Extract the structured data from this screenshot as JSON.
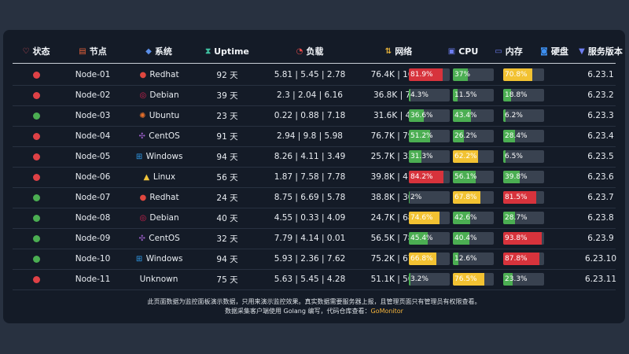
{
  "colors": {
    "online": "#4bae52",
    "offline": "#df4146",
    "bar_green": "#4bae52",
    "bar_yellow": "#f2c232",
    "bar_red": "#d7333c",
    "bar_track": "#394250",
    "link": "#f4b33b"
  },
  "headers": [
    {
      "key": "status",
      "label": "状态",
      "icon": "heart-pulse-icon",
      "glyph": "♡",
      "color": "#e35560"
    },
    {
      "key": "node",
      "label": "节点",
      "icon": "server-icon",
      "glyph": "▤",
      "color": "#e8623a"
    },
    {
      "key": "os",
      "label": "系统",
      "icon": "layers-icon",
      "glyph": "◆",
      "color": "#5b8fe8"
    },
    {
      "key": "uptime",
      "label": "Uptime",
      "icon": "hourglass-icon",
      "glyph": "⧗",
      "color": "#3fc0a0"
    },
    {
      "key": "load",
      "label": "负载",
      "icon": "gauge-icon",
      "glyph": "◔",
      "color": "#e24a4a"
    },
    {
      "key": "network",
      "label": "网络",
      "icon": "updown-arrows-icon",
      "glyph": "⇅",
      "color": "#e6b23a"
    },
    {
      "key": "cpu",
      "label": "CPU",
      "icon": "cpu-icon",
      "glyph": "▣",
      "color": "#6d7df0"
    },
    {
      "key": "memory",
      "label": "内存",
      "icon": "memory-icon",
      "glyph": "▭",
      "color": "#6d7df0"
    },
    {
      "key": "disk",
      "label": "硬盘",
      "icon": "disk-icon",
      "glyph": "◙",
      "color": "#3d8ff0"
    },
    {
      "key": "version",
      "label": "服务版本",
      "icon": "version-icon",
      "glyph": "▼",
      "color": "#6d7df0"
    }
  ],
  "rows": [
    {
      "status": "offline",
      "node": "Node-01",
      "os": "Redhat",
      "os_icon": "redhat-icon",
      "os_glyph": "●",
      "os_color": "#e0473f",
      "uptime": "92 天",
      "load": "5.81 | 5.45 | 2.78",
      "network": "76.4K | 16.8K",
      "cpu": 81.9,
      "cpu_label": "81.9%",
      "memory": 37,
      "memory_label": "37%",
      "disk": 70.8,
      "disk_label": "70.8%",
      "version": "6.23.1"
    },
    {
      "status": "offline",
      "node": "Node-02",
      "os": "Debian",
      "os_icon": "debian-icon",
      "os_glyph": "◎",
      "os_color": "#d7214f",
      "uptime": "39 天",
      "load": "2.3 | 2.04 | 6.16",
      "network": "36.8K | 7.5K",
      "cpu": 4.3,
      "cpu_label": "4.3%",
      "memory": 11.5,
      "memory_label": "11.5%",
      "disk": 18.8,
      "disk_label": "18.8%",
      "version": "6.23.2"
    },
    {
      "status": "online",
      "node": "Node-03",
      "os": "Ubuntu",
      "os_icon": "ubuntu-icon",
      "os_glyph": "✺",
      "os_color": "#e8702a",
      "uptime": "23 天",
      "load": "0.22 | 0.88 | 7.18",
      "network": "31.6K | 4.8K",
      "cpu": 36.6,
      "cpu_label": "36.6%",
      "memory": 43.4,
      "memory_label": "43.4%",
      "disk": 6.2,
      "disk_label": "6.2%",
      "version": "6.23.3"
    },
    {
      "status": "offline",
      "node": "Node-04",
      "os": "CentOS",
      "os_icon": "centos-icon",
      "os_glyph": "✣",
      "os_color": "#9c5ec9",
      "uptime": "91 天",
      "load": "2.94 | 9.8 | 5.98",
      "network": "76.7K | 79.5K",
      "cpu": 51.2,
      "cpu_label": "51.2%",
      "memory": 26.2,
      "memory_label": "26.2%",
      "disk": 28.4,
      "disk_label": "28.4%",
      "version": "6.23.4"
    },
    {
      "status": "offline",
      "node": "Node-05",
      "os": "Windows",
      "os_icon": "windows-icon",
      "os_glyph": "⊞",
      "os_color": "#2f9ae8",
      "uptime": "94 天",
      "load": "8.26 | 4.11 | 3.49",
      "network": "25.7K | 33.8K",
      "cpu": 31.3,
      "cpu_label": "31.3%",
      "memory": 62.2,
      "memory_label": "62.2%",
      "disk": 6.5,
      "disk_label": "6.5%",
      "version": "6.23.5"
    },
    {
      "status": "offline",
      "node": "Node-06",
      "os": "Linux",
      "os_icon": "linux-icon",
      "os_glyph": "▲",
      "os_color": "#f0c43a",
      "uptime": "56 天",
      "load": "1.87 | 7.58 | 7.78",
      "network": "39.8K | 41.3K",
      "cpu": 84.2,
      "cpu_label": "84.2%",
      "memory": 56.1,
      "memory_label": "56.1%",
      "disk": 39.8,
      "disk_label": "39.8%",
      "version": "6.23.6"
    },
    {
      "status": "online",
      "node": "Node-07",
      "os": "Redhat",
      "os_icon": "redhat-icon",
      "os_glyph": "●",
      "os_color": "#e0473f",
      "uptime": "24 天",
      "load": "8.75 | 6.69 | 5.78",
      "network": "38.8K | 30.7K",
      "cpu": 2,
      "cpu_label": "2%",
      "memory": 67.8,
      "memory_label": "67.8%",
      "disk": 81.5,
      "disk_label": "81.5%",
      "version": "6.23.7"
    },
    {
      "status": "online",
      "node": "Node-08",
      "os": "Debian",
      "os_icon": "debian-icon",
      "os_glyph": "◎",
      "os_color": "#d7214f",
      "uptime": "40 天",
      "load": "4.55 | 0.33 | 4.09",
      "network": "24.7K | 68.1K",
      "cpu": 74.6,
      "cpu_label": "74.6%",
      "memory": 42.6,
      "memory_label": "42.6%",
      "disk": 28.7,
      "disk_label": "28.7%",
      "version": "6.23.8"
    },
    {
      "status": "online",
      "node": "Node-09",
      "os": "CentOS",
      "os_icon": "centos-icon",
      "os_glyph": "✣",
      "os_color": "#9c5ec9",
      "uptime": "32 天",
      "load": "7.79 | 4.14 | 0.01",
      "network": "56.5K | 78.1K",
      "cpu": 45.4,
      "cpu_label": "45.4%",
      "memory": 40.4,
      "memory_label": "40.4%",
      "disk": 93.8,
      "disk_label": "93.8%",
      "version": "6.23.9"
    },
    {
      "status": "online",
      "node": "Node-10",
      "os": "Windows",
      "os_icon": "windows-icon",
      "os_glyph": "⊞",
      "os_color": "#2f9ae8",
      "uptime": "94 天",
      "load": "5.93 | 2.36 | 7.62",
      "network": "75.2K | 67.4K",
      "cpu": 66.8,
      "cpu_label": "66.8%",
      "memory": 12.6,
      "memory_label": "12.6%",
      "disk": 87.8,
      "disk_label": "87.8%",
      "version": "6.23.10"
    },
    {
      "status": "offline",
      "node": "Node-11",
      "os": "Unknown",
      "os_icon": "",
      "os_glyph": "",
      "os_color": "#e9edf2",
      "uptime": "75 天",
      "load": "5.63 | 5.45 | 4.28",
      "network": "51.1K | 50.4K",
      "cpu": 3.2,
      "cpu_label": "3.2%",
      "memory": 76.5,
      "memory_label": "76.5%",
      "disk": 23.3,
      "disk_label": "23.3%",
      "version": "6.23.11"
    }
  ],
  "footer": {
    "line1": "此页面数据为监控面板演示数据，只用来演示监控效果。真实数据需要服务器上报，且管理页面只有管理员有权限查看。",
    "line2_prefix": "数据采集客户端使用 Golang 编写，代码仓库查看：",
    "link_text": "GoMonitor"
  }
}
